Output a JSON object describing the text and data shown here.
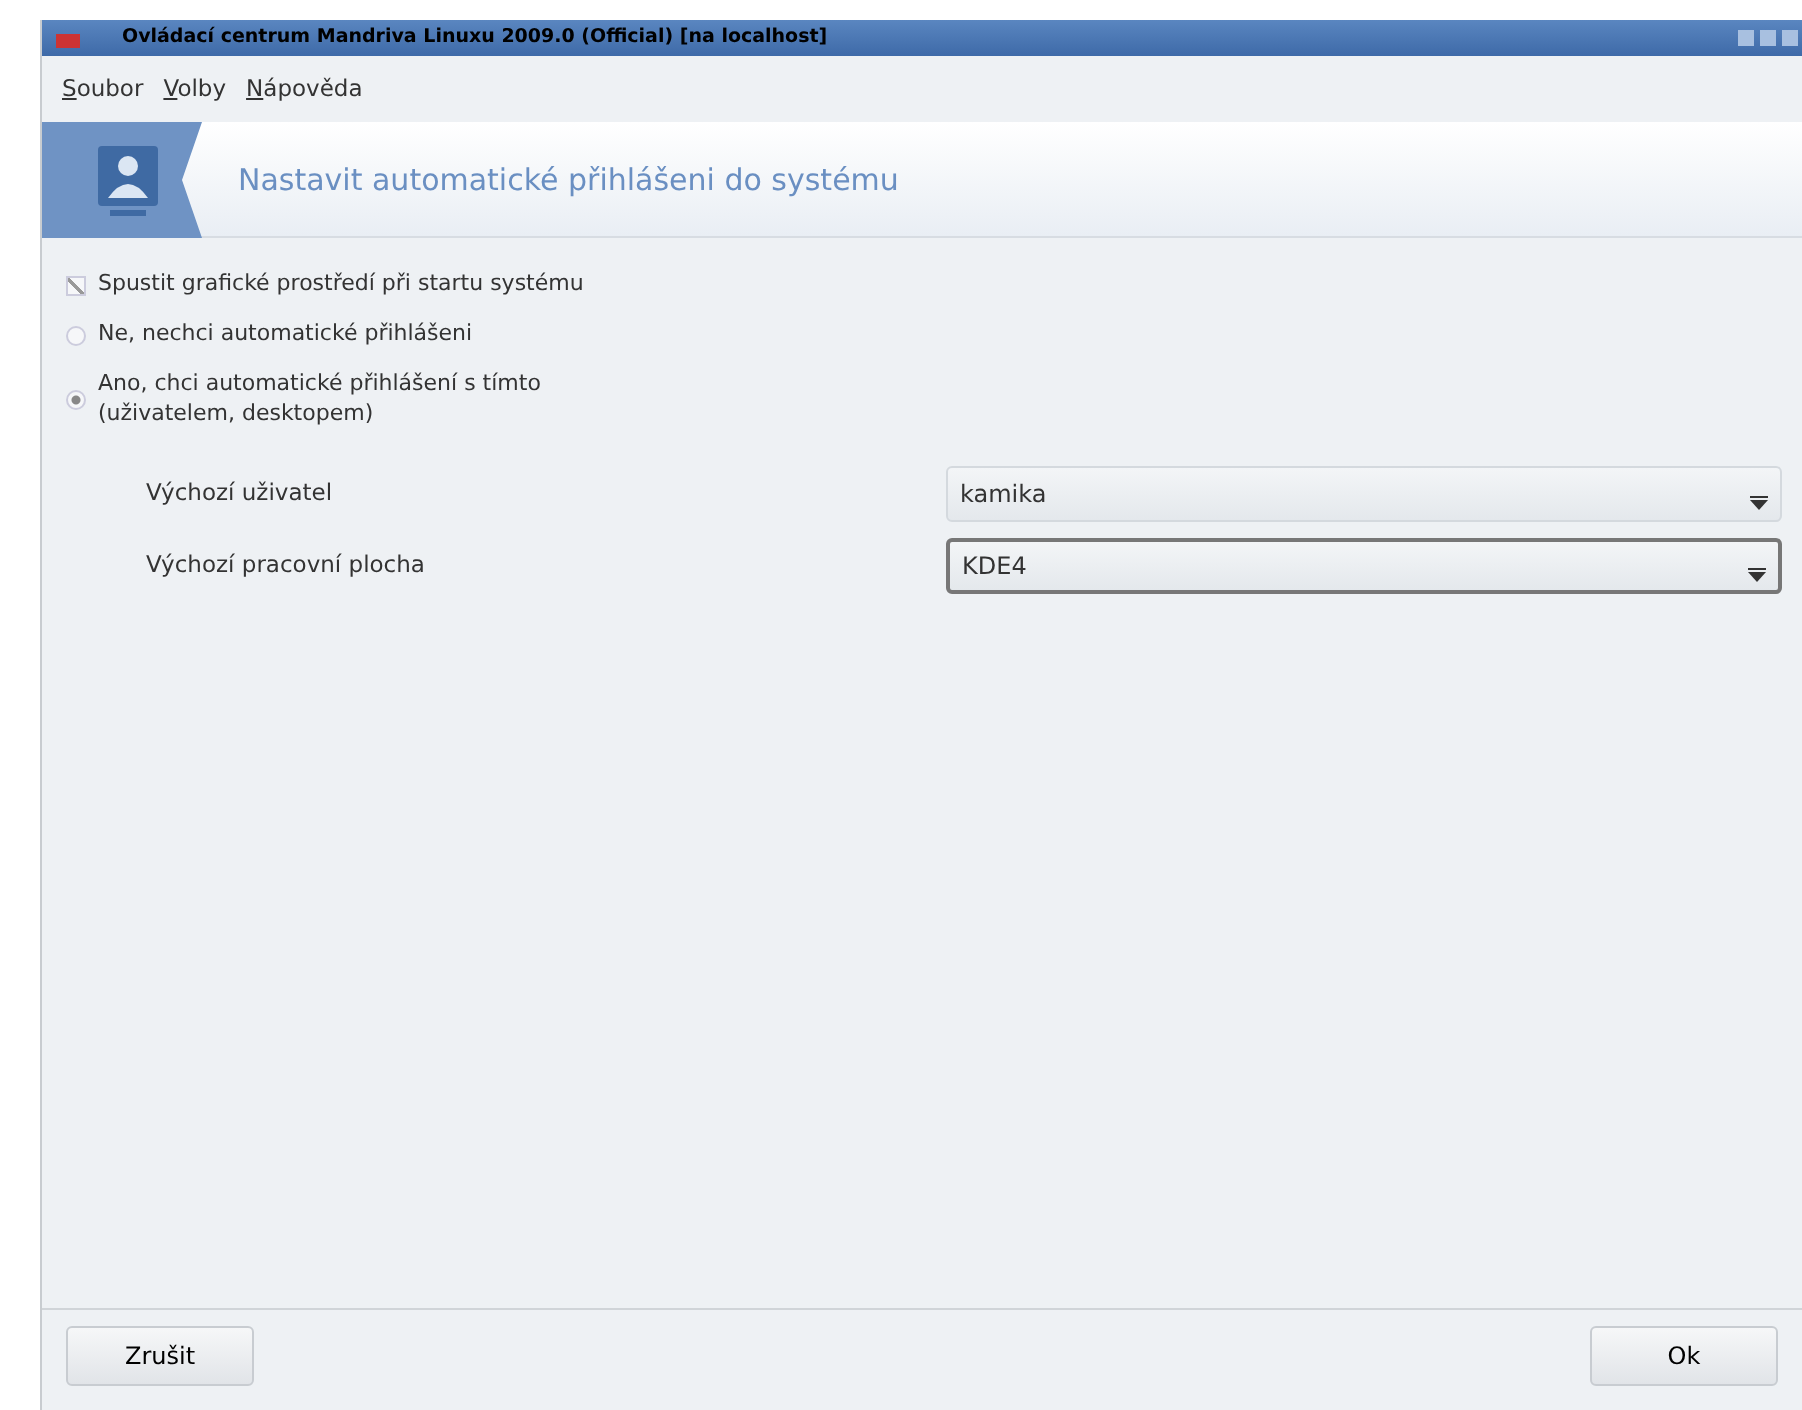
{
  "window": {
    "title": "Ovládací centrum Mandriva Linuxu 2009.0 (Official) [na localhost]"
  },
  "menu": [
    {
      "label": "Soubor"
    },
    {
      "label": "Volby"
    },
    {
      "label": "Nápověda"
    }
  ],
  "header": {
    "title": "Nastavit automatické přihlášeni do systému"
  },
  "options": [
    {
      "kind": "checkbox",
      "label": "Spustit grafické prostředí při startu systému",
      "checked": true
    },
    {
      "kind": "radio",
      "label": "Ne, nechci automatické přihlášeni",
      "selected": false
    },
    {
      "kind": "radio",
      "label": "Ano, chci automatické přihlášení s tímto (uživatelem, desktopem)",
      "selected": true
    }
  ],
  "fields": [
    {
      "label": "Výchozí uživatel",
      "value": "kamika",
      "focused": false
    },
    {
      "label": "Výchozí pracovní plocha",
      "value": "KDE4",
      "focused": true
    }
  ],
  "buttons": [
    {
      "label": "Zrušit"
    },
    {
      "label": "Ok"
    }
  ]
}
